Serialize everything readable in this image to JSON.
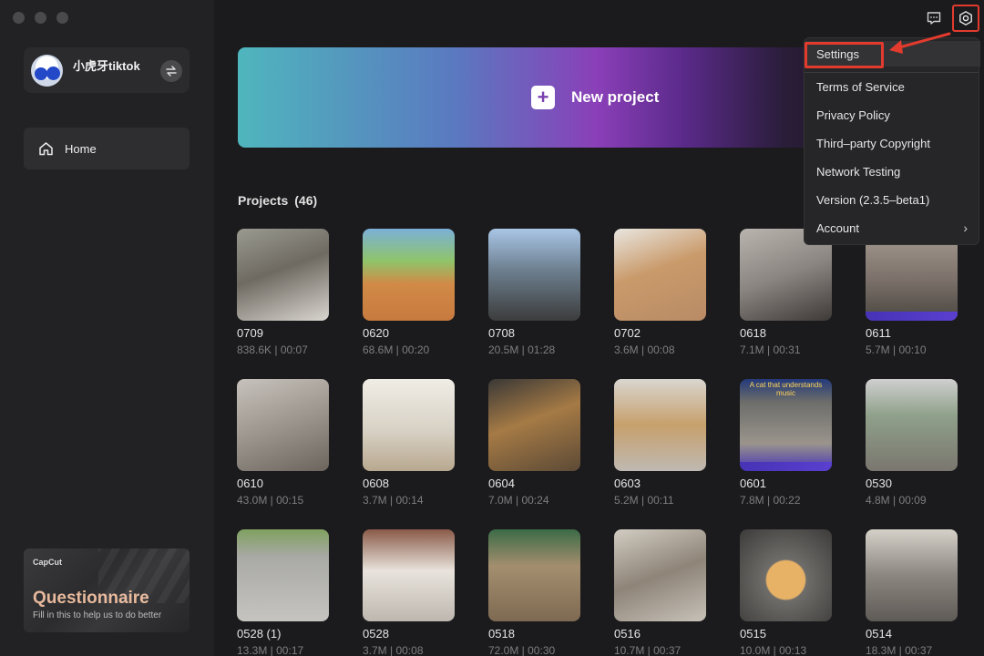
{
  "user": {
    "name": "小虎牙tiktok"
  },
  "nav": {
    "home_label": "Home"
  },
  "questionnaire": {
    "brand": "CapCut",
    "title": "Questionnaire",
    "subtitle": "Fill in this to help us to do better"
  },
  "new_project": {
    "label": "New project"
  },
  "projects": {
    "title": "Projects (46)",
    "items": [
      {
        "name": "0709",
        "meta": "838.6K | 00:07",
        "bg": "linear-gradient(160deg,#9a9a90 0%,#6e6a62 45%,#d9d6cf 100%)"
      },
      {
        "name": "0620",
        "meta": "68.6M | 00:20",
        "bg": "linear-gradient(180deg,#7bb0d8 0%,#8fc46a 35%,#d18a47 60%,#c87a3e 100%)"
      },
      {
        "name": "0708",
        "meta": "20.5M | 01:28",
        "bg": "linear-gradient(180deg,#a9c6e6 0%,#6d7f8f 45%,#3c3c3c 100%)"
      },
      {
        "name": "0702",
        "meta": "3.6M | 00:08",
        "bg": "linear-gradient(160deg,#e9e6e0 0%,#c99a6a 45%,#b98b66 100%)"
      },
      {
        "name": "0618",
        "meta": "7.1M | 00:31",
        "bg": "linear-gradient(160deg,#b9b4ae 0%,#8a8580 50%,#3e3a38 100%)"
      },
      {
        "name": "0611",
        "meta": "5.7M | 00:10",
        "bg": "linear-gradient(180deg,#a79d94 0%,#7b716a 55%,#4a4640 100%)",
        "band": true
      },
      {
        "name": "0610",
        "meta": "43.0M | 00:15",
        "bg": "linear-gradient(160deg,#c7c2bc 0%,#9c958d 50%,#6b655e 100%)"
      },
      {
        "name": "0608",
        "meta": "3.7M | 00:14",
        "bg": "linear-gradient(180deg,#f0ede6 0%,#d8d2c6 55%,#b8a88f 100%)"
      },
      {
        "name": "0604",
        "meta": "7.0M | 00:24",
        "bg": "linear-gradient(160deg,#3a3836 0%,#a57a45 45%,#5c4a36 100%)"
      },
      {
        "name": "0603",
        "meta": "5.2M | 00:11",
        "bg": "linear-gradient(180deg,#d9d6d0 0%,#c7a06c 50%,#bfb9b2 100%)"
      },
      {
        "name": "0601",
        "meta": "7.8M | 00:22",
        "bg": "linear-gradient(180deg,#243a7a 0%,#6d6d6a 25%,#9a948c 70%,#4633b5 100%)",
        "caption": "A cat that understands music",
        "band": true
      },
      {
        "name": "0530",
        "meta": "4.8M | 00:09",
        "bg": "linear-gradient(180deg,#cfcfcf 0%,#8fa08a 40%,#7a766f 100%)"
      },
      {
        "name": "0528 (1)",
        "meta": "13.3M | 00:17",
        "bg": "linear-gradient(180deg,#7fa15f 0%,#a9a9a6 30%,#c5c4c0 100%)"
      },
      {
        "name": "0528",
        "meta": "3.7M | 00:08",
        "bg": "linear-gradient(180deg,#8a5a48 0%,#e8e3dc 45%,#bdb7af 100%)"
      },
      {
        "name": "0518",
        "meta": "72.0M | 00:30",
        "bg": "linear-gradient(180deg,#3c6b46 0%,#a48e6f 40%,#7e6a52 100%)"
      },
      {
        "name": "0516",
        "meta": "10.7M | 00:37",
        "bg": "linear-gradient(160deg,#d2ccc2 0%,#8e8478 50%,#c7c1b8 100%)"
      },
      {
        "name": "0515",
        "meta": "10.0M | 00:13",
        "bg": "radial-gradient(circle at 50% 55%,#e7b166 0 28%,#6e6d6a 30%,#3c3b39 100%)"
      },
      {
        "name": "0514",
        "meta": "18.3M | 00:37",
        "bg": "linear-gradient(180deg,#d5d0c8 0%,#8b8680 50%,#5e5a55 100%)"
      }
    ]
  },
  "menu": {
    "items": [
      {
        "label": "Settings",
        "chevron": ""
      },
      {
        "label": "Terms of Service",
        "chevron": ""
      },
      {
        "label": "Privacy Policy",
        "chevron": ""
      },
      {
        "label": "Third–party Copyright",
        "chevron": ""
      },
      {
        "label": "Network Testing",
        "chevron": ""
      },
      {
        "label": "Version (2.3.5–beta1)",
        "chevron": ""
      },
      {
        "label": "Account",
        "chevron": "›"
      }
    ]
  },
  "colors": {
    "accent_red": "#e23b2e",
    "background": "#1b1b1d",
    "sidebar": "#222224"
  },
  "icons": {
    "settings": "gear-icon",
    "feedback": "feedback-icon",
    "home": "home-icon",
    "switch": "switch-account-icon",
    "add": "plus-icon"
  }
}
